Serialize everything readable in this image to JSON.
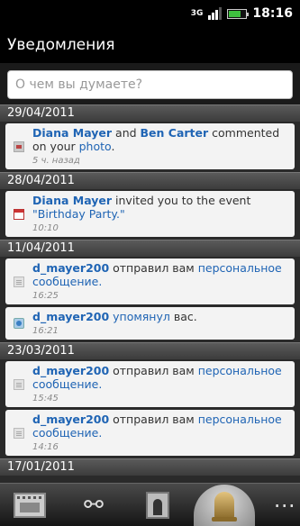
{
  "status_bar": {
    "network": "3G",
    "time": "18:16",
    "battery_level": 0.7,
    "signal_bars": 3
  },
  "title": "Уведомления",
  "search": {
    "placeholder": "О чем вы думаете?"
  },
  "groups": [
    {
      "date": "29/04/2011",
      "items": [
        {
          "icon": "photo-icon",
          "user1": "Diana Mayer",
          "joiner": " and ",
          "user2": "Ben Carter",
          "text": " commented on your ",
          "link": "photo",
          "suffix": ".",
          "time": "5 ч. назад"
        }
      ]
    },
    {
      "date": "28/04/2011",
      "items": [
        {
          "icon": "calendar-icon",
          "user1": "Diana Mayer",
          "text": " invited you to the event ",
          "link": "\"Birthday Party.\"",
          "time": "10:10"
        }
      ]
    },
    {
      "date": "11/04/2011",
      "items": [
        {
          "icon": "message-icon",
          "user1": "d_mayer200",
          "text": " отправил вам ",
          "link": "персональное сообщение.",
          "time": "16:25"
        },
        {
          "icon": "globe-icon",
          "user1": "d_mayer200",
          "text": " ",
          "link": "упомянул",
          "suffix": " вас.",
          "time": "16:21"
        }
      ]
    },
    {
      "date": "23/03/2011",
      "items": [
        {
          "icon": "message-icon",
          "user1": "d_mayer200",
          "text": " отправил вам ",
          "link": "персональное сообщение.",
          "time": "15:45"
        },
        {
          "icon": "message-icon",
          "user1": "d_mayer200",
          "text": " отправил вам ",
          "link": "персональное сообщение.",
          "time": "14:16"
        }
      ]
    },
    {
      "date": "17/01/2011",
      "items": []
    }
  ],
  "tabs": [
    {
      "name": "news-feed-tab",
      "icon": "film-icon",
      "selected": false
    },
    {
      "name": "links-tab",
      "icon": "chain-link-icon",
      "selected": false
    },
    {
      "name": "contacts-tab",
      "icon": "contact-card-icon",
      "selected": false
    },
    {
      "name": "notifications-tab",
      "icon": "bell-icon",
      "selected": true
    },
    {
      "name": "more-tab",
      "icon": "more-icon",
      "selected": false
    }
  ]
}
